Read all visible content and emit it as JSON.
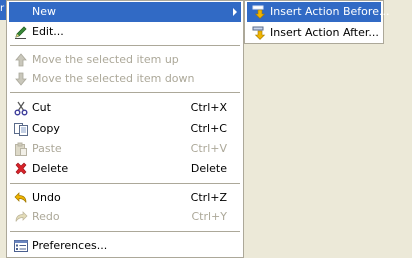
{
  "left_strip": {
    "glyph": "r"
  },
  "menu": {
    "items": [
      {
        "label": "New",
        "icon": "none",
        "selected": true,
        "submenu": true
      },
      {
        "label": "Edit...",
        "icon": "pencil-icon"
      },
      {
        "label": "Move the selected item up",
        "icon": "arrow-up-icon",
        "disabled": true
      },
      {
        "label": "Move the selected item down",
        "icon": "arrow-down-icon",
        "disabled": true
      },
      {
        "label": "Cut",
        "shortcut": "Ctrl+X",
        "icon": "scissors-icon"
      },
      {
        "label": "Copy",
        "shortcut": "Ctrl+C",
        "icon": "copy-icon"
      },
      {
        "label": "Paste",
        "shortcut": "Ctrl+V",
        "icon": "paste-icon",
        "disabled": true
      },
      {
        "label": "Delete",
        "shortcut": "Delete",
        "icon": "delete-icon"
      },
      {
        "label": "Undo",
        "shortcut": "Ctrl+Z",
        "icon": "undo-icon"
      },
      {
        "label": "Redo",
        "shortcut": "Ctrl+Y",
        "icon": "redo-icon",
        "disabled": true
      },
      {
        "label": "Preferences...",
        "icon": "preferences-icon"
      }
    ]
  },
  "submenu": {
    "items": [
      {
        "label": "Insert Action Before...",
        "icon": "insert-before-icon",
        "selected": true
      },
      {
        "label": "Insert Action After...",
        "icon": "insert-after-icon"
      }
    ]
  },
  "colors": {
    "selection": "#316AC5",
    "background": "#ECE9D8",
    "disabled_text": "#ACA899",
    "menu_bg": "#FFFFFF"
  }
}
